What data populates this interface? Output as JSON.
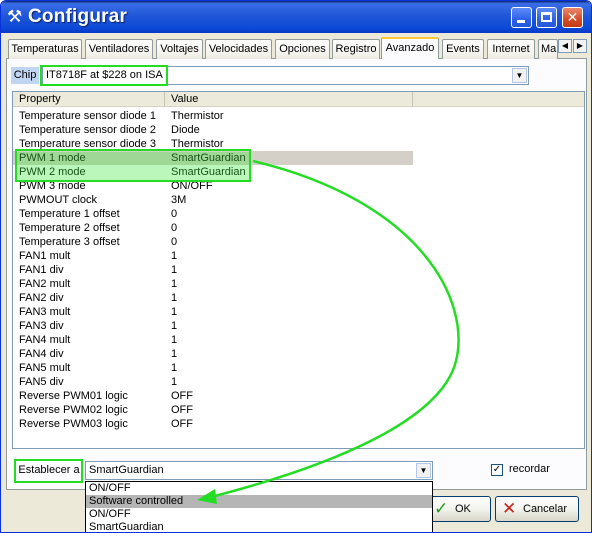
{
  "window": {
    "title": "Configurar"
  },
  "tabs": [
    {
      "label": "Temperaturas"
    },
    {
      "label": "Ventiladores"
    },
    {
      "label": "Voltajes"
    },
    {
      "label": "Velocidades"
    },
    {
      "label": "Opciones"
    },
    {
      "label": "Registro"
    },
    {
      "label": "Avanzado",
      "active": true
    },
    {
      "label": "Events"
    },
    {
      "label": "Internet"
    },
    {
      "label": "Ma"
    }
  ],
  "chip": {
    "label": "Chip",
    "value": "IT8718F at $228 on ISA"
  },
  "list": {
    "columns": [
      "Property",
      "Value"
    ],
    "rows": [
      {
        "property": "Temperature sensor diode 1",
        "value": "Thermistor"
      },
      {
        "property": "Temperature sensor diode 2",
        "value": "Diode"
      },
      {
        "property": "Temperature sensor diode 3",
        "value": "Thermistor"
      },
      {
        "property": "PWM 1 mode",
        "value": "SmartGuardian",
        "selected": true
      },
      {
        "property": "PWM 2 mode",
        "value": "SmartGuardian"
      },
      {
        "property": "PWM 3 mode",
        "value": "ON/OFF"
      },
      {
        "property": "PWMOUT clock",
        "value": "3M"
      },
      {
        "property": "Temperature 1 offset",
        "value": "0"
      },
      {
        "property": "Temperature 2 offset",
        "value": "0"
      },
      {
        "property": "Temperature 3 offset",
        "value": "0"
      },
      {
        "property": "FAN1 mult",
        "value": "1"
      },
      {
        "property": "FAN1 div",
        "value": "1"
      },
      {
        "property": "FAN2 mult",
        "value": "1"
      },
      {
        "property": "FAN2 div",
        "value": "1"
      },
      {
        "property": "FAN3 mult",
        "value": "1"
      },
      {
        "property": "FAN3 div",
        "value": "1"
      },
      {
        "property": "FAN4 mult",
        "value": "1"
      },
      {
        "property": "FAN4 div",
        "value": "1"
      },
      {
        "property": "FAN5 mult",
        "value": "1"
      },
      {
        "property": "FAN5 div",
        "value": "1"
      },
      {
        "property": "Reverse PWM01 logic",
        "value": "OFF"
      },
      {
        "property": "Reverse PWM02 logic",
        "value": "OFF"
      },
      {
        "property": "Reverse PWM03 logic",
        "value": "OFF"
      }
    ]
  },
  "set_to": {
    "label": "Establecer a",
    "value": "SmartGuardian",
    "options": [
      {
        "label": "ON/OFF"
      },
      {
        "label": "Software controlled",
        "highlighted": true
      },
      {
        "label": "ON/OFF"
      },
      {
        "label": "SmartGuardian"
      }
    ]
  },
  "remember": {
    "label": "recordar",
    "checked": true
  },
  "buttons": {
    "ok": "OK",
    "cancel": "Cancelar"
  },
  "colors": {
    "annotation": "#22dd22",
    "titlebar": "#0b49d6",
    "active_tab_accent": "#ffc83c"
  },
  "icons": {
    "app": "tools-icon",
    "ok": "checkmark-icon",
    "cancel": "x-icon"
  }
}
